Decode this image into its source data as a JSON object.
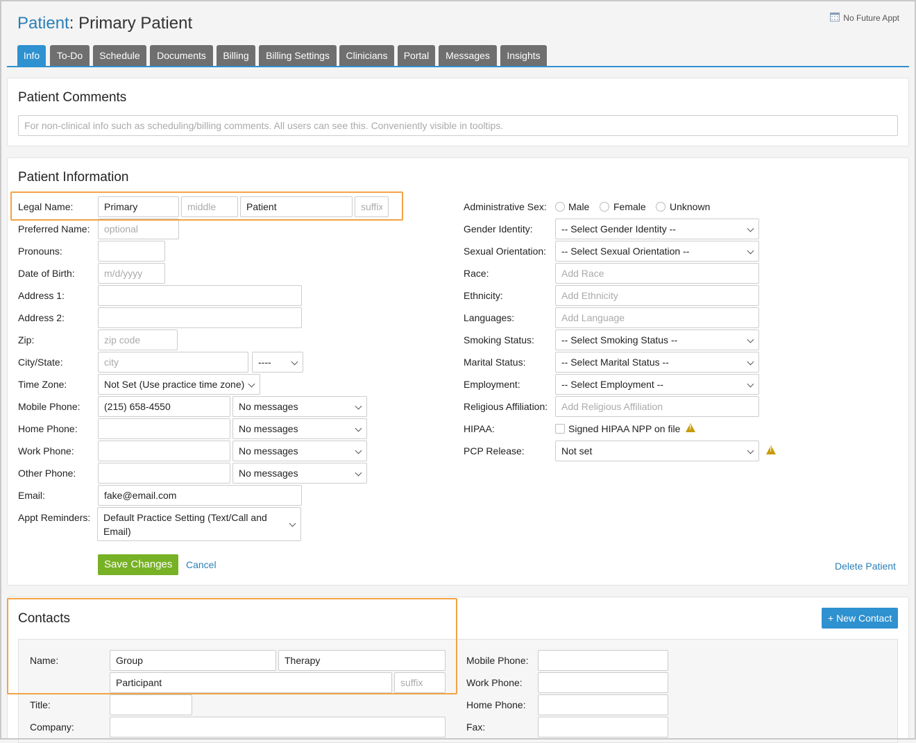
{
  "header": {
    "crumb": "Patient",
    "separator": ": ",
    "title": "Primary Patient",
    "future_appt": "No Future Appt"
  },
  "tabs": [
    {
      "label": "Info"
    },
    {
      "label": "To-Do"
    },
    {
      "label": "Schedule"
    },
    {
      "label": "Documents"
    },
    {
      "label": "Billing"
    },
    {
      "label": "Billing Settings"
    },
    {
      "label": "Clinicians"
    },
    {
      "label": "Portal"
    },
    {
      "label": "Messages"
    },
    {
      "label": "Insights"
    }
  ],
  "comments": {
    "title": "Patient Comments",
    "placeholder": "For non-clinical info such as scheduling/billing comments. All users can see this. Conveniently visible in tooltips."
  },
  "info": {
    "title": "Patient Information",
    "legal_name": {
      "label": "Legal Name:",
      "first": "Primary",
      "middle_placeholder": "middle",
      "last": "Patient",
      "suffix_placeholder": "suffix"
    },
    "preferred_name": {
      "label": "Preferred Name:",
      "placeholder": "optional"
    },
    "pronouns": {
      "label": "Pronouns:"
    },
    "dob": {
      "label": "Date of Birth:",
      "placeholder": "m/d/yyyy"
    },
    "address1": {
      "label": "Address 1:"
    },
    "address2": {
      "label": "Address 2:"
    },
    "zip": {
      "label": "Zip:",
      "placeholder": "zip code"
    },
    "city_state": {
      "label": "City/State:",
      "city_placeholder": "city",
      "state": "----"
    },
    "time_zone": {
      "label": "Time Zone:",
      "value": "Not Set (Use practice time zone)"
    },
    "mobile_phone": {
      "label": "Mobile Phone:",
      "value": "(215) 658-4550",
      "pref": "No messages"
    },
    "home_phone": {
      "label": "Home Phone:",
      "pref": "No messages"
    },
    "work_phone": {
      "label": "Work Phone:",
      "pref": "No messages"
    },
    "other_phone": {
      "label": "Other Phone:",
      "pref": "No messages"
    },
    "email": {
      "label": "Email:",
      "value": "fake@email.com"
    },
    "appt_reminders": {
      "label": "Appt Reminders:",
      "value": "Default Practice Setting (Text/Call and Email)"
    },
    "save_label": "Save Changes",
    "cancel_label": "Cancel",
    "delete_label": "Delete Patient",
    "admin_sex": {
      "label": "Administrative Sex:",
      "options": [
        "Male",
        "Female",
        "Unknown"
      ]
    },
    "gender_identity": {
      "label": "Gender Identity:",
      "value": "-- Select Gender Identity --"
    },
    "sexual_orientation": {
      "label": "Sexual Orientation:",
      "value": "-- Select Sexual Orientation --"
    },
    "race": {
      "label": "Race:",
      "placeholder": "Add Race"
    },
    "ethnicity": {
      "label": "Ethnicity:",
      "placeholder": "Add Ethnicity"
    },
    "languages": {
      "label": "Languages:",
      "placeholder": "Add Language"
    },
    "smoking": {
      "label": "Smoking Status:",
      "value": "-- Select Smoking Status --"
    },
    "marital": {
      "label": "Marital Status:",
      "value": "-- Select Marital Status --"
    },
    "employment": {
      "label": "Employment:",
      "value": "-- Select Employment --"
    },
    "religion": {
      "label": "Religious Affiliation:",
      "placeholder": "Add Religious Affiliation"
    },
    "hipaa": {
      "label": "HIPAA:",
      "checkbox_label": "Signed HIPAA NPP on file"
    },
    "pcp": {
      "label": "PCP Release:",
      "value": "Not set"
    }
  },
  "contacts": {
    "title": "Contacts",
    "new_label": "+ New Contact",
    "name_label": "Name:",
    "first": "Group",
    "middle": "Therapy",
    "last": "Participant",
    "suffix_placeholder": "suffix",
    "title_label": "Title:",
    "company_label": "Company:",
    "mobile_label": "Mobile Phone:",
    "work_label": "Work Phone:",
    "home_label": "Home Phone:",
    "fax_label": "Fax:"
  },
  "colors": {
    "accent": "#2e91d0",
    "tab_inactive": "#6f6f6f",
    "save": "#77b125",
    "highlight": "#f2a343",
    "warning": "#c99a00"
  }
}
